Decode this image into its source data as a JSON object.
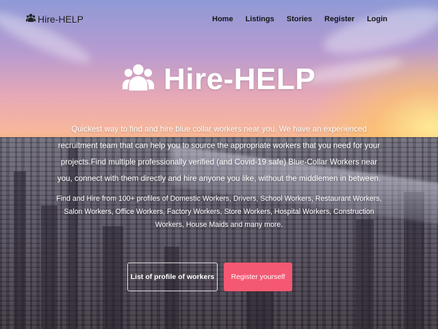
{
  "nav": {
    "brand": "Hire-HELP",
    "links": [
      "Home",
      "Listings",
      "Stories",
      "Register",
      "Login"
    ]
  },
  "hero": {
    "title": "Hire-HELP",
    "tagline": "Quickest way to find and hire blue collar workers near you. We have an experienced recruitment team that can help you to source the appropriate workers that you need for your projects.Find multiple professionally verified (and Covid-19 safe) Blue-Collar Workers near you, connect with them directly and hire anyone you like, without the middlemen in between.",
    "profiles_text": "Find and Hire from 100+ profiles of Domestic Workers, Drivers, School Workers, Restaurant Workers, Salon Workers, Office Workers, Factory Workers, Store Workers, Hospital Workers, Construction Workers, House Maids and many more.",
    "buttons": {
      "list": "List of profile of workers",
      "register": "Register yourself"
    }
  },
  "colors": {
    "accent": "#f45872",
    "text_light": "#ffffff",
    "nav_text": "#151515"
  },
  "icons": {
    "brand": "users-icon",
    "title": "users-icon"
  }
}
